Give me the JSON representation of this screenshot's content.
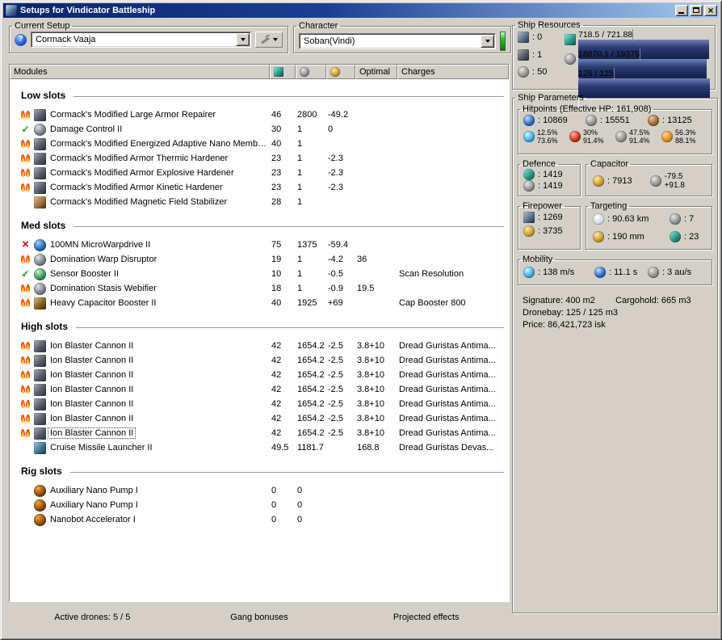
{
  "window": {
    "title": "Setups for Vindicator Battleship"
  },
  "current_setup": {
    "label": "Current Setup",
    "selected": "Cormack Vaaja"
  },
  "character": {
    "label": "Character",
    "selected": "Soban(Vindi)"
  },
  "modules_table": {
    "columns": {
      "modules": "Modules",
      "optimal": "Optimal",
      "charges": "Charges"
    },
    "sections": [
      {
        "title": "Low slots",
        "rows": [
          {
            "status": "overheat",
            "icon": "armor-repairer",
            "name": "Cormack's Modified Large Armor Repairer",
            "cpu": "46",
            "grid": "2800",
            "cap": "-49.2",
            "optimal": "",
            "charges": ""
          },
          {
            "status": "active",
            "icon": "damage-control",
            "name": "Damage Control II",
            "cpu": "30",
            "grid": "1",
            "cap": "0",
            "optimal": "",
            "charges": ""
          },
          {
            "status": "overheat",
            "icon": "nano-membrane",
            "name": "Cormack's Modified Energized Adaptive Nano Membrane",
            "cpu": "40",
            "grid": "1",
            "cap": "",
            "optimal": "",
            "charges": ""
          },
          {
            "status": "overheat",
            "icon": "armor-hardener",
            "name": "Cormack's Modified Armor Thermic Hardener",
            "cpu": "23",
            "grid": "1",
            "cap": "-2.3",
            "optimal": "",
            "charges": ""
          },
          {
            "status": "overheat",
            "icon": "armor-hardener",
            "name": "Cormack's Modified Armor Explosive Hardener",
            "cpu": "23",
            "grid": "1",
            "cap": "-2.3",
            "optimal": "",
            "charges": ""
          },
          {
            "status": "overheat",
            "icon": "armor-hardener",
            "name": "Cormack's Modified Armor Kinetic Hardener",
            "cpu": "23",
            "grid": "1",
            "cap": "-2.3",
            "optimal": "",
            "charges": ""
          },
          {
            "status": "none",
            "icon": "mag-stab",
            "name": "Cormack's Modified Magnetic Field Stabilizer",
            "cpu": "28",
            "grid": "1",
            "cap": "",
            "optimal": "",
            "charges": ""
          }
        ]
      },
      {
        "title": "Med slots",
        "rows": [
          {
            "status": "offline",
            "icon": "mwd",
            "name": "100MN MicroWarpdrive II",
            "cpu": "75",
            "grid": "1375",
            "cap": "-59.4",
            "optimal": "",
            "charges": ""
          },
          {
            "status": "overheat",
            "icon": "warp-disruptor",
            "name": "Domination Warp Disruptor",
            "cpu": "19",
            "grid": "1",
            "cap": "-4.2",
            "optimal": "36",
            "charges": ""
          },
          {
            "status": "active",
            "icon": "sensor-booster",
            "name": "Sensor Booster II",
            "cpu": "10",
            "grid": "1",
            "cap": "-0.5",
            "optimal": "",
            "charges": "Scan Resolution"
          },
          {
            "status": "overheat",
            "icon": "stasis-webifier",
            "name": "Domination Stasis Webifier",
            "cpu": "18",
            "grid": "1",
            "cap": "-0.9",
            "optimal": "19.5",
            "charges": ""
          },
          {
            "status": "overheat",
            "icon": "cap-booster",
            "name": "Heavy Capacitor Booster II",
            "cpu": "40",
            "grid": "1925",
            "cap": "+69",
            "optimal": "",
            "charges": "Cap Booster 800"
          }
        ]
      },
      {
        "title": "High slots",
        "rows": [
          {
            "status": "overheat",
            "icon": "blaster",
            "name": "Ion Blaster Cannon II",
            "cpu": "42",
            "grid": "1654.2",
            "cap": "-2.5",
            "optimal": "3.8+10",
            "charges": "Dread Guristas Antima..."
          },
          {
            "status": "overheat",
            "icon": "blaster",
            "name": "Ion Blaster Cannon II",
            "cpu": "42",
            "grid": "1654.2",
            "cap": "-2.5",
            "optimal": "3.8+10",
            "charges": "Dread Guristas Antima..."
          },
          {
            "status": "overheat",
            "icon": "blaster",
            "name": "Ion Blaster Cannon II",
            "cpu": "42",
            "grid": "1654.2",
            "cap": "-2.5",
            "optimal": "3.8+10",
            "charges": "Dread Guristas Antima..."
          },
          {
            "status": "overheat",
            "icon": "blaster",
            "name": "Ion Blaster Cannon II",
            "cpu": "42",
            "grid": "1654.2",
            "cap": "-2.5",
            "optimal": "3.8+10",
            "charges": "Dread Guristas Antima..."
          },
          {
            "status": "overheat",
            "icon": "blaster",
            "name": "Ion Blaster Cannon II",
            "cpu": "42",
            "grid": "1654.2",
            "cap": "-2.5",
            "optimal": "3.8+10",
            "charges": "Dread Guristas Antima..."
          },
          {
            "status": "overheat",
            "icon": "blaster",
            "name": "Ion Blaster Cannon II",
            "cpu": "42",
            "grid": "1654.2",
            "cap": "-2.5",
            "optimal": "3.8+10",
            "charges": "Dread Guristas Antima..."
          },
          {
            "status": "overheat",
            "icon": "blaster",
            "name": "Ion Blaster Cannon II",
            "cpu": "42",
            "grid": "1654.2",
            "cap": "-2.5",
            "optimal": "3.8+10",
            "charges": "Dread Guristas Antima...",
            "selected": true
          },
          {
            "status": "none",
            "icon": "cruise-launcher",
            "name": "Cruise Missile Launcher II",
            "cpu": "49.5",
            "grid": "1181.7",
            "cap": "",
            "optimal": "168.8",
            "charges": "Dread Guristas Devas..."
          }
        ]
      },
      {
        "title": "Rig slots",
        "rows": [
          {
            "status": "none",
            "icon": "rig",
            "name": "Auxiliary Nano Pump I",
            "cpu": "0",
            "grid": "0",
            "cap": "",
            "optimal": "",
            "charges": ""
          },
          {
            "status": "none",
            "icon": "rig",
            "name": "Auxiliary Nano Pump I",
            "cpu": "0",
            "grid": "0",
            "cap": "",
            "optimal": "",
            "charges": ""
          },
          {
            "status": "none",
            "icon": "rig",
            "name": "Nanobot Accelerator I",
            "cpu": "0",
            "grid": "0",
            "cap": "",
            "optimal": "",
            "charges": ""
          }
        ]
      }
    ]
  },
  "footer": {
    "active_drones": "Active drones: 5 / 5",
    "gang_bonuses": "Gang bonuses",
    "projected_effects": "Projected effects"
  },
  "ship_resources": {
    "title": "Ship Resources",
    "turrets": ": 0",
    "launchers": ": 1",
    "calibration": ": 50",
    "bars": {
      "cpu": {
        "text": "718.5 / 721.88",
        "pct": 99.5
      },
      "powergrid": {
        "text": "18870.1 / 19375",
        "pct": 97.4
      },
      "drones": {
        "text": "125 / 125",
        "pct": 100
      }
    }
  },
  "ship_parameters": {
    "title": "Ship Parameters",
    "hitpoints": {
      "title": "Hitpoints (Effective HP: 161,908)",
      "shield": ": 10869",
      "armor": ": 15551",
      "structure": ": 13125",
      "resists": [
        {
          "type": "em",
          "top": "12.5%",
          "bottom": "73.6%"
        },
        {
          "type": "thermal",
          "top": "30%",
          "bottom": "91.4%"
        },
        {
          "type": "kinetic",
          "top": "47.5%",
          "bottom": "91.4%"
        },
        {
          "type": "explosive",
          "top": "56.3%",
          "bottom": "88.1%"
        }
      ]
    },
    "defence": {
      "title": "Defence",
      "values": [
        ": 1419",
        ": 1419"
      ]
    },
    "capacitor": {
      "title": "Capacitor",
      "amount": ": 7913",
      "drain": "-79.5",
      "recharge": "+91.8"
    },
    "firepower": {
      "title": "Firepower",
      "dps": ": 1269",
      "volley": ": 3735"
    },
    "targeting": {
      "title": "Targeting",
      "range": ": 90.63 km",
      "max_targets": ": 7",
      "scan_resolution": ": 190 mm",
      "sensor_strength": ": 23"
    },
    "mobility": {
      "title": "Mobility",
      "speed": ": 138 m/s",
      "align_time": ": 11.1 s",
      "warp_speed": ": 3 au/s"
    },
    "signature": "Signature: 400 m2",
    "cargohold": "Cargohold: 665 m3",
    "dronebay": "Dronebay: 125 / 125 m3",
    "price": "Price: 86,421,723 isk"
  }
}
